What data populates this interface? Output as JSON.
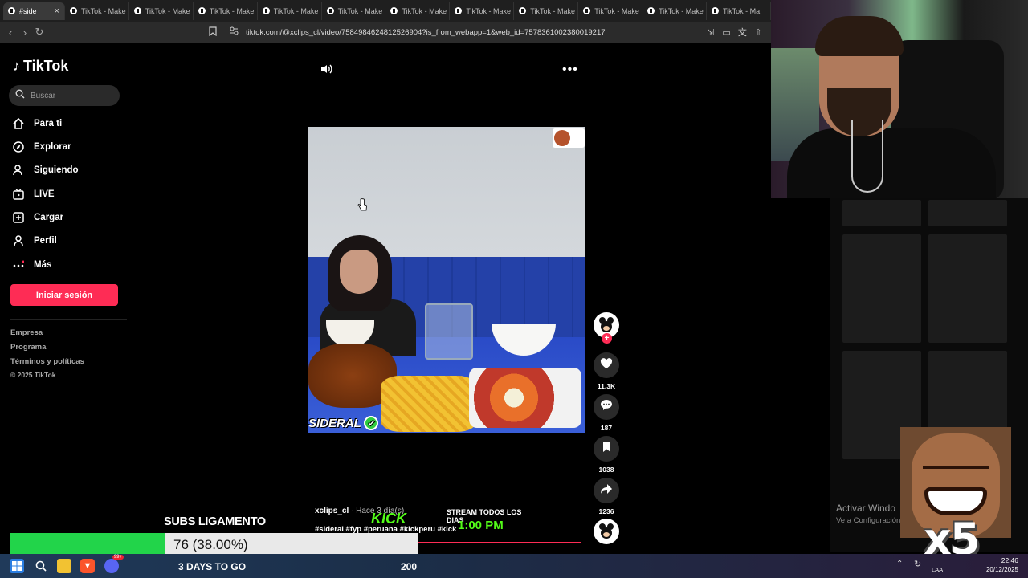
{
  "browser": {
    "tabs": [
      {
        "label": "#side",
        "active": true
      },
      {
        "label": "TikTok - Make"
      },
      {
        "label": "TikTok - Make"
      },
      {
        "label": "TikTok - Make"
      },
      {
        "label": "TikTok - Make"
      },
      {
        "label": "TikTok - Make"
      },
      {
        "label": "TikTok - Make"
      },
      {
        "label": "TikTok - Make"
      },
      {
        "label": "TikTok - Make"
      },
      {
        "label": "TikTok - Make"
      },
      {
        "label": "TikTok - Make"
      },
      {
        "label": "TikTok - Ma"
      }
    ],
    "url": "tiktok.com/@xclips_cl/video/7584984624812526904?is_from_webapp=1&web_id=7578361002380019217"
  },
  "tiktok": {
    "logo": "TikTok",
    "search_placeholder": "Buscar",
    "nav": [
      {
        "label": "Para ti",
        "icon": "home-icon"
      },
      {
        "label": "Explorar",
        "icon": "compass-icon"
      },
      {
        "label": "Siguiendo",
        "icon": "following-icon"
      },
      {
        "label": "LIVE",
        "icon": "live-icon"
      },
      {
        "label": "Cargar",
        "icon": "upload-icon"
      },
      {
        "label": "Perfil",
        "icon": "profile-icon"
      },
      {
        "label": "Más",
        "icon": "more-icon"
      }
    ],
    "login_button": "Iniciar sesión",
    "footer": [
      "Empresa",
      "Programa",
      "Términos y políticas",
      "© 2025 TikTok"
    ],
    "video": {
      "overlay_text": "SIDERAL",
      "author": "xclips_cl",
      "when": " · Hace 3 día(s)",
      "tags": "#sideral #fyp #peruana #kickperu #kick"
    },
    "actions": {
      "likes": "11.3K",
      "comments": "187",
      "saves": "1038",
      "shares": "1236"
    },
    "follow_symbol": "+"
  },
  "stream_promo": {
    "brand": "KICK",
    "line1": "STREAM TODOS LOS DIAS",
    "line2": "1:00 PM"
  },
  "windows_watermark": {
    "title": "Activar Windo",
    "subtitle": "Ve a Configuración"
  },
  "meme": {
    "multiplier": "x5"
  },
  "subs_goal": {
    "title": "SUBS LIGAMENTO",
    "current": "76 (38.00%)",
    "fraction": 0.38,
    "days_left": "3 DAYS TO GO",
    "target": "200"
  },
  "taskbar": {
    "language": "LAA",
    "time": "22:46",
    "date": "20/12/2025",
    "notification_badge": "99+"
  },
  "colors": {
    "accent": "#fe2c55",
    "goal_fill": "#22d44a",
    "kick_green": "#53fc18"
  }
}
